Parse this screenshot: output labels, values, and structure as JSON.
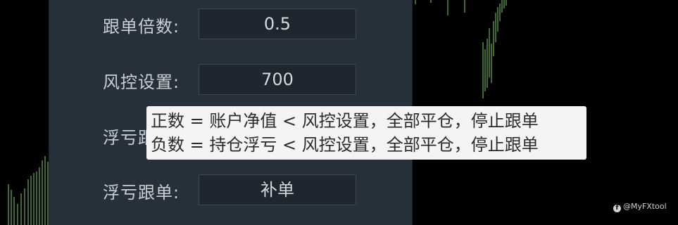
{
  "settings": {
    "follow_multiplier": {
      "label": "跟单倍数:",
      "value": "0.5"
    },
    "risk_control": {
      "label": "风控设置:",
      "value": "700"
    },
    "floating_loss_partial": {
      "label": "浮亏跟"
    },
    "floating_loss_follow": {
      "label": "浮亏跟单:",
      "value": "补单"
    }
  },
  "tooltip": {
    "line1": "正数 = 账户净值 < 风控设置，全部平仓，停止跟单",
    "line2": "负数 = 持仓浮亏 < 风控设置，全部平仓，停止跟单"
  },
  "watermark": {
    "icon": "facebook-icon",
    "text": "@MyFXtool"
  },
  "colors": {
    "panel": "#26303a",
    "field": "#1e272f",
    "candle": "#7cd65a",
    "tooltip_bg": "#f4f4f4"
  }
}
